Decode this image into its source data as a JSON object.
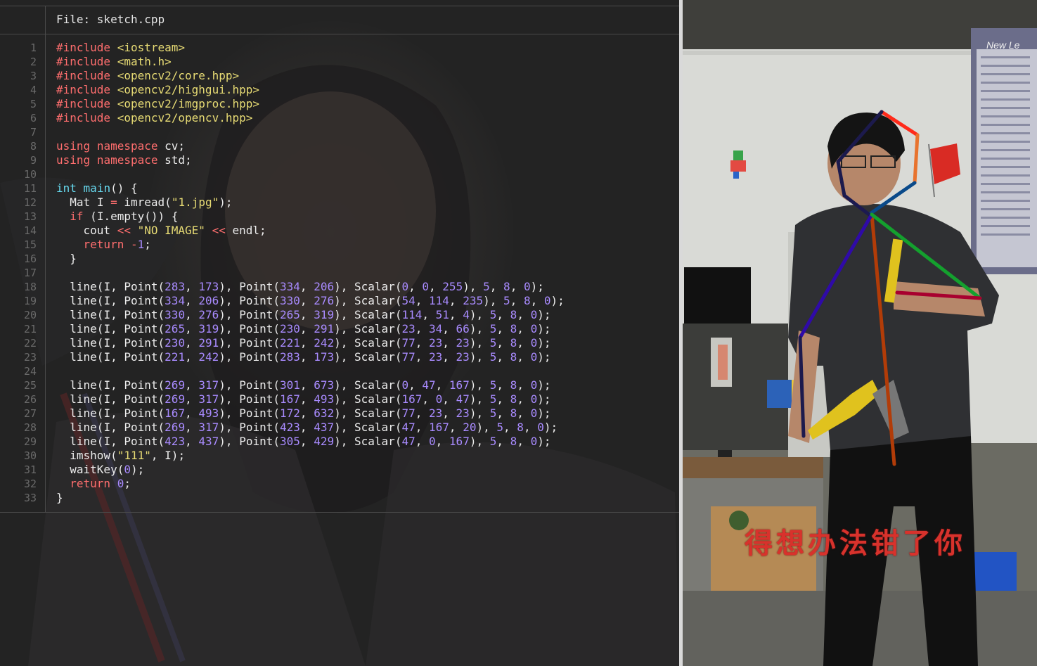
{
  "editor": {
    "file_label": "File: sketch.cpp",
    "line_numbers": [
      "1",
      "2",
      "3",
      "4",
      "5",
      "6",
      "7",
      "8",
      "9",
      "10",
      "11",
      "12",
      "13",
      "14",
      "15",
      "16",
      "17",
      "18",
      "19",
      "20",
      "21",
      "22",
      "23",
      "24",
      "25",
      "26",
      "27",
      "28",
      "29",
      "30",
      "31",
      "32",
      "33"
    ],
    "code_lines": [
      "#include <iostream>",
      "#include <math.h>",
      "#include <opencv2/core.hpp>",
      "#include <opencv2/highgui.hpp>",
      "#include <opencv2/imgproc.hpp>",
      "#include <opencv2/opencv.hpp>",
      "",
      "using namespace cv;",
      "using namespace std;",
      "",
      "int main() {",
      "  Mat I = imread(\"1.jpg\");",
      "  if (I.empty()) {",
      "    cout << \"NO IMAGE\" << endl;",
      "    return -1;",
      "  }",
      "",
      "  line(I, Point(283, 173), Point(334, 206), Scalar(0, 0, 255), 5, 8, 0);",
      "  line(I, Point(334, 206), Point(330, 276), Scalar(54, 114, 235), 5, 8, 0);",
      "  line(I, Point(330, 276), Point(265, 319), Scalar(114, 51, 4), 5, 8, 0);",
      "  line(I, Point(265, 319), Point(230, 291), Scalar(23, 34, 66), 5, 8, 0);",
      "  line(I, Point(230, 291), Point(221, 242), Scalar(77, 23, 23), 5, 8, 0);",
      "  line(I, Point(221, 242), Point(283, 173), Scalar(77, 23, 23), 5, 8, 0);",
      "",
      "  line(I, Point(269, 317), Point(301, 673), Scalar(0, 47, 167), 5, 8, 0);",
      "  line(I, Point(269, 317), Point(167, 493), Scalar(167, 0, 47), 5, 8, 0);",
      "  line(I, Point(167, 493), Point(172, 632), Scalar(77, 23, 23), 5, 8, 0);",
      "  line(I, Point(269, 317), Point(423, 437), Scalar(47, 167, 20), 5, 8, 0);",
      "  line(I, Point(423, 437), Point(305, 429), Scalar(47, 0, 167), 5, 8, 0);",
      "  imshow(\"111\", I);",
      "  waitKey(0);",
      "  return 0;",
      "}"
    ]
  },
  "photo": {
    "caption": "得想办法钳了你",
    "board_title": "New Le",
    "skeleton_colors": [
      "#ff2a1a",
      "#e8732e",
      "#0a4a8a",
      "#1c1a50",
      "#1c1a4d",
      "#1c1a4d",
      "#b23c08",
      "#2f0aa8",
      "#1c1a4d",
      "#14a02e",
      "#a8002f"
    ]
  },
  "colors": {
    "editor_bg": "#242424",
    "preprocessor": "#ff6e6e",
    "string": "#e7db74",
    "type": "#66d9ef",
    "number": "#a98bff",
    "caption_red": "#d8322c"
  }
}
